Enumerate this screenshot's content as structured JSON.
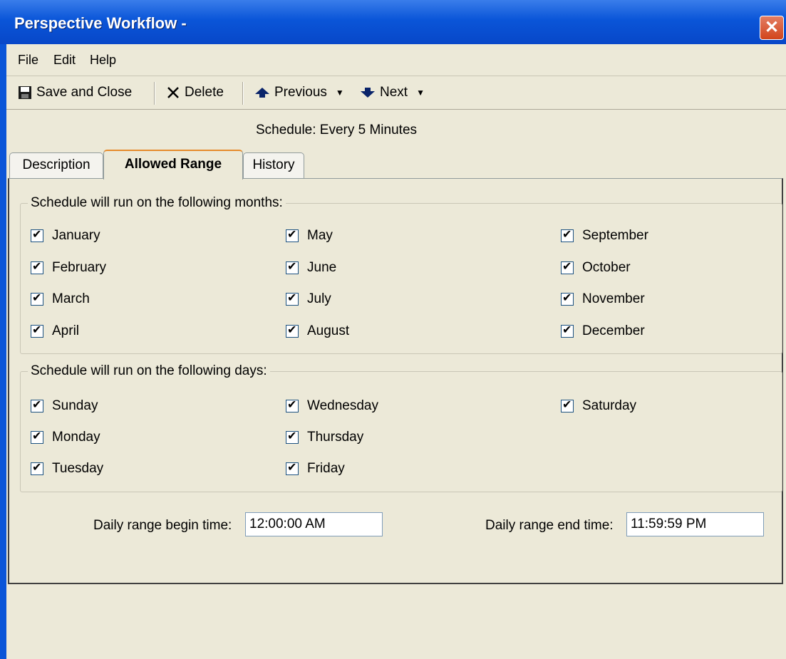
{
  "window": {
    "title": "Perspective Workflow -"
  },
  "menu": [
    "File",
    "Edit",
    "Help"
  ],
  "toolbar": {
    "save": "Save and Close",
    "delete": "Delete",
    "previous": "Previous",
    "next": "Next"
  },
  "schedule_text": "Schedule:  Every 5 Minutes",
  "tabs": [
    "Description",
    "Allowed Range",
    "History"
  ],
  "months": {
    "label": "Schedule will run on the following months:",
    "items": [
      "January",
      "February",
      "March",
      "April",
      "May",
      "June",
      "July",
      "August",
      "September",
      "October",
      "November",
      "December"
    ]
  },
  "days": {
    "label": "Schedule will run on the following days:",
    "items": [
      "Sunday",
      "Monday",
      "Tuesday",
      "Wednesday",
      "Thursday",
      "Friday",
      "Saturday"
    ]
  },
  "time": {
    "begin_label": "Daily range begin time:",
    "begin_value": "12:00:00 AM",
    "end_label": "Daily range end time:",
    "end_value": "11:59:59 PM"
  }
}
